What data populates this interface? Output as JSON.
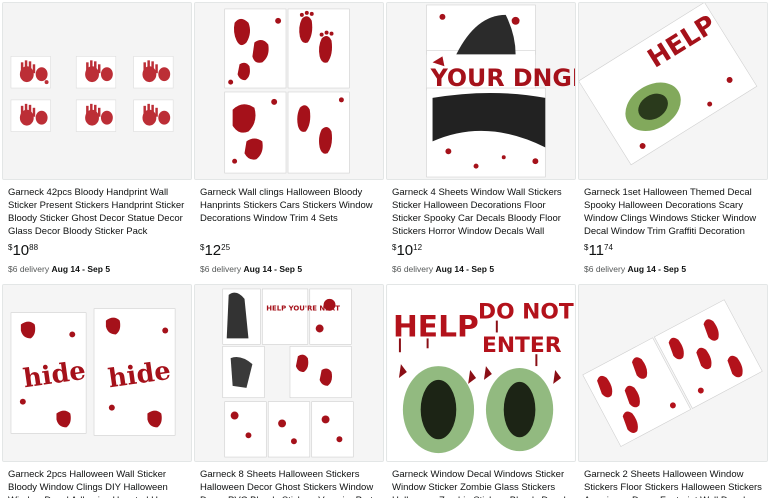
{
  "products": [
    {
      "title": "Garneck 42pcs Bloody Handprint Wall Sticker Present Stickers Handprint Sticker Bloody Sticker Ghost Decor Statue Decor Glass Decor Bloody Sticker Pack Halloween Bloody Stick...",
      "price_currency": "$",
      "price_whole": "10",
      "price_fraction": "88",
      "delivery_prefix": "$6 delivery",
      "delivery_dates": "Aug 14 - Sep 5",
      "image_icon": "handprint-stickers-sheet"
    },
    {
      "title": "Garneck Wall clings Halloween Bloody Hanprints Stickers Cars Stickers Window Decorations Window Trim 4 Sets",
      "price_currency": "$",
      "price_whole": "12",
      "price_fraction": "25",
      "delivery_prefix": "$6 delivery",
      "delivery_dates": "Aug 14 - Sep 5",
      "image_icon": "bloody-footprint-sheets"
    },
    {
      "title": "Garneck 4 Sheets Window Wall Stickers Sticker Halloween Decorations Floor Sticker Spooky Car Decals Bloody Floor Stickers Horror Window Decals Wall Decor Hallowee...",
      "price_currency": "$",
      "price_whole": "10",
      "price_fraction": "12",
      "delivery_prefix": "$6 delivery",
      "delivery_dates": "Aug 14 - Sep 5",
      "image_icon": "danger-window-stickers",
      "image_text": "YOUR DNGR"
    },
    {
      "title": "Garneck 1set Halloween Themed Decal Spooky Halloween Decorations Scary Window Clings Windows Sticker Window Decal Window Trim Graffiti Decoration Blood Han...",
      "price_currency": "$",
      "price_whole": "11",
      "price_fraction": "74",
      "delivery_prefix": "$6 delivery",
      "delivery_dates": "Aug 14 - Sep 5",
      "image_icon": "help-zombie-decal",
      "image_text": "HELP"
    },
    {
      "title": "Garneck 2pcs Halloween Wall Sticker Bloody Window Clings DIY Halloween Window Decal Adhesive Haunted House Decals Wall Decals",
      "image_icon": "hide-bloody-window-clings",
      "image_text": "hide"
    },
    {
      "title": "Garneck 8 Sheets Halloween Stickers Halloween Decor Ghost Stickers Window Decor PVC Bloody Stickers Vampire Party",
      "image_icon": "help-youre-next-sticker-sheets",
      "image_text": "HELP YOU'RE NEXT"
    },
    {
      "title": "Garneck Window Decal Windows Sticker Window Sticker Zombie Glass Stickers Halloween Zombie Stickers Bloody Decals",
      "image_icon": "help-do-not-enter-zombie",
      "image_text_1": "HELP",
      "image_text_2": "DO NOT",
      "image_text_3": "ENTER"
    },
    {
      "title": "Garneck 2 Sheets Halloween Window Stickers Floor Stickers Halloween Stickers Americana Decor Footprint Wall Decal Bloody Deco",
      "image_icon": "bloody-footprint-floor-stickers"
    }
  ],
  "colors": {
    "blood": "#b3121b",
    "blood_dark": "#7d0a10",
    "zombie_green": "#4f8a3c",
    "text_secondary": "#565959"
  }
}
